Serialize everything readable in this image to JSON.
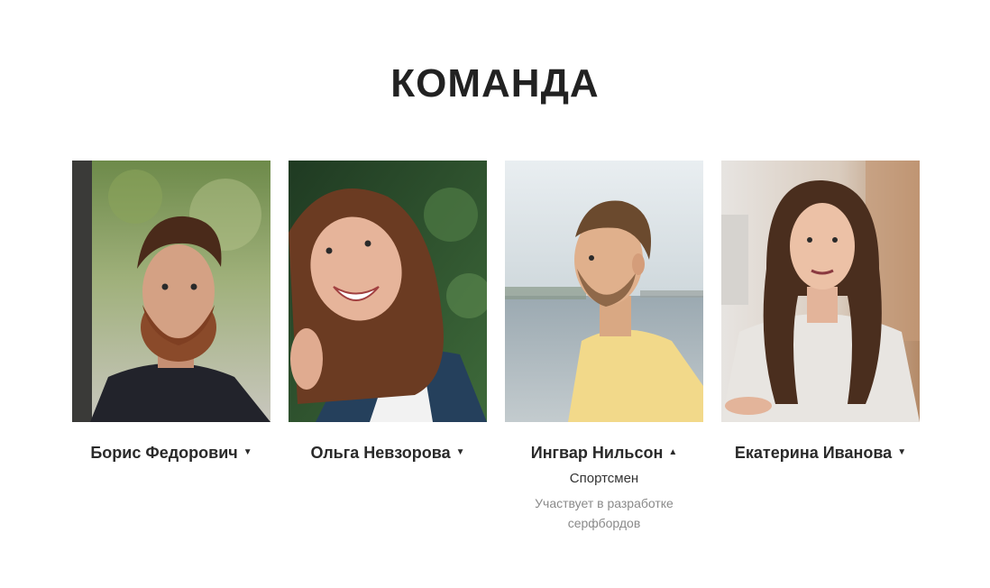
{
  "section": {
    "title": "КОМАНДА"
  },
  "members": [
    {
      "name": "Борис Федорович",
      "toggle_icon": "▼",
      "toggle_icon_name": "chevron-down-icon",
      "expanded": false
    },
    {
      "name": "Ольга Невзорова",
      "toggle_icon": "▼",
      "toggle_icon_name": "chevron-down-icon",
      "expanded": false
    },
    {
      "name": "Ингвар Нильсон",
      "toggle_icon": "▲",
      "toggle_icon_name": "chevron-up-icon",
      "expanded": true,
      "role": "Спортсмен",
      "description": "Участвует в разработке серфбордов"
    },
    {
      "name": "Екатерина Иванова",
      "toggle_icon": "▼",
      "toggle_icon_name": "chevron-down-icon",
      "expanded": false
    }
  ],
  "colors": {
    "title": "#222222",
    "name": "#2a2a2a",
    "role": "#333333",
    "description": "#8a8a8a",
    "background": "#ffffff"
  }
}
